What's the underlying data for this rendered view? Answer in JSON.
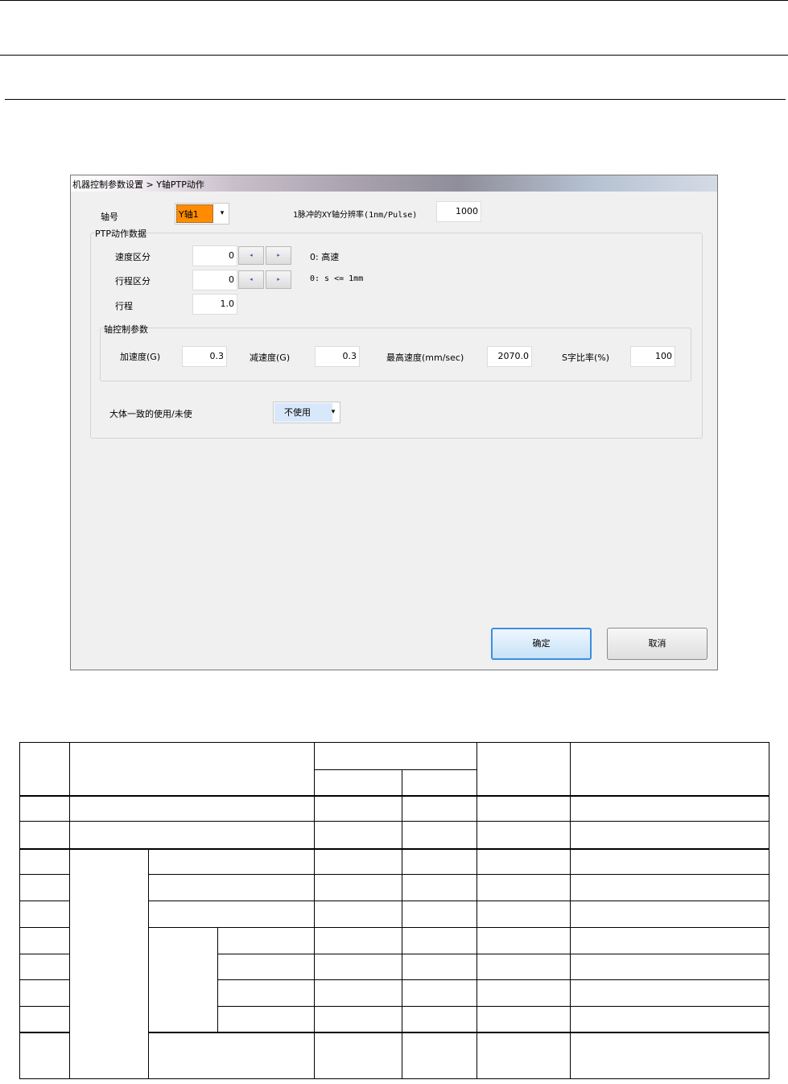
{
  "dialog": {
    "title": "机器控制参数设置 > Y轴PTP动作",
    "axis_label": "轴号",
    "axis_value": "Y轴1",
    "resolution_label": "1脉冲的XY轴分辨率(1nm/Pulse)",
    "resolution_value": "1000",
    "ptp_group_title": "PTP动作数据",
    "speed_div_label": "速度区分",
    "speed_div_value": "0",
    "speed_div_note": "0: 高速",
    "stroke_div_label": "行程区分",
    "stroke_div_value": "0",
    "stroke_div_note": "0: s <= 1mm",
    "stroke_label": "行程",
    "stroke_value": "1.0",
    "axis_ctrl_title": "轴控制参数",
    "accel_label": "加速度(G)",
    "accel_value": "0.3",
    "decel_label": "减速度(G)",
    "decel_value": "0.3",
    "maxspeed_label": "最高速度(mm/sec)",
    "maxspeed_value": "2070.0",
    "sratio_label": "S字比率(%)",
    "sratio_value": "100",
    "approx_label": "大体一致的使用/未使",
    "approx_value": "不使用",
    "ok_label": "确定",
    "cancel_label": "取消",
    "spin_left_icon": "◂",
    "spin_right_icon": "▸",
    "dropdown_icon": "▾"
  },
  "colors": {
    "axis_highlight": "#ff8c00",
    "combo_highlight": "#d8e8fb",
    "ok_border": "#3d8ee0"
  }
}
